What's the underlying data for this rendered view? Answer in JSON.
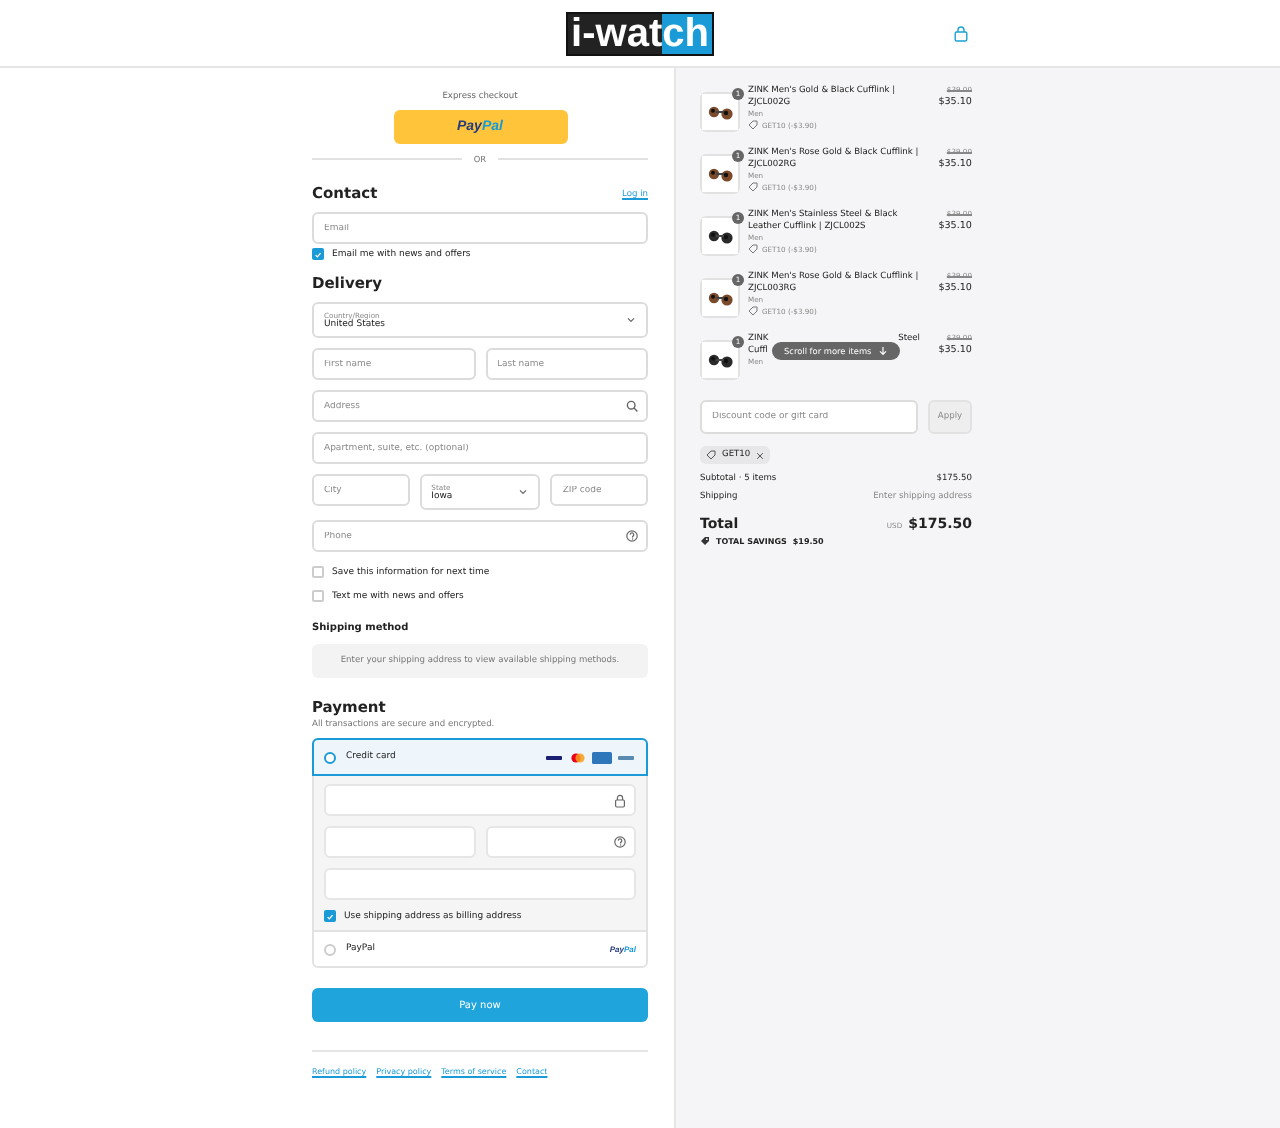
{
  "header": {
    "logo_parts": [
      {
        "text": "i-wat",
        "kind": "dark"
      },
      {
        "text": "ch",
        "kind": "blue"
      }
    ]
  },
  "express": {
    "label": "Express checkout",
    "paypal_parts": [
      {
        "text": "Pay",
        "kind": "dark"
      },
      {
        "text": "Pal",
        "kind": "light"
      }
    ],
    "divider": "OR"
  },
  "contact": {
    "heading": "Contact",
    "login_link": "Log in",
    "email_placeholder": "Email",
    "news_checkbox": {
      "label": "Email me with news and offers",
      "checked": true
    }
  },
  "delivery": {
    "heading": "Delivery",
    "rows": [
      [
        {
          "kind": "select",
          "label": "Country/Region",
          "value": "United States"
        }
      ],
      [
        {
          "kind": "input",
          "placeholder": "First name"
        },
        {
          "kind": "input",
          "placeholder": "Last name"
        }
      ],
      [
        {
          "kind": "address",
          "placeholder": "Address"
        }
      ],
      [
        {
          "kind": "input",
          "placeholder": "Apartment, suite, etc. (optional)"
        }
      ],
      [
        {
          "kind": "input",
          "placeholder": "City"
        },
        {
          "kind": "select",
          "label": "State",
          "value": "Iowa"
        },
        {
          "kind": "input",
          "placeholder": "ZIP code"
        }
      ],
      [
        {
          "kind": "phone",
          "placeholder": "Phone"
        }
      ]
    ],
    "checkboxes": [
      {
        "label": "Save this information for next time",
        "checked": false
      },
      {
        "label": "Text me with news and offers",
        "checked": false
      }
    ]
  },
  "shipping_method": {
    "heading": "Shipping method",
    "message": "Enter your shipping address to view available shipping methods."
  },
  "payment": {
    "heading": "Payment",
    "note": "All transactions are secure and encrypted.",
    "methods": [
      {
        "kind": "card",
        "label": "Credit card",
        "selected": true
      },
      {
        "kind": "paypal",
        "label": "PayPal",
        "selected": false,
        "logo_parts": [
          {
            "text": "Pay",
            "kind": "dark"
          },
          {
            "text": "Pal",
            "kind": "light"
          }
        ]
      }
    ],
    "card_fields": [
      [
        {
          "kind": "secure"
        }
      ],
      [
        {
          "kind": "plain"
        },
        {
          "kind": "help"
        }
      ],
      [
        {
          "kind": "plain"
        }
      ]
    ],
    "billing_checkbox": {
      "label": "Use shipping address as billing address",
      "checked": true
    }
  },
  "pay_button": "Pay now",
  "footer_links": [
    "Refund policy",
    "Privacy policy",
    "Terms of service",
    "Contact"
  ],
  "order": {
    "items": [
      {
        "quantity": "1",
        "title": "ZINK Men's Gold & Black Cufflink | ZJCL002G",
        "variant": "Men",
        "discount": "GET10 (-$3.90)",
        "old_price": "$39.00",
        "price": "$35.10"
      },
      {
        "quantity": "1",
        "title": "ZINK Men's Rose Gold & Black Cufflink | ZJCL002RG",
        "variant": "Men",
        "discount": "GET10 (-$3.90)",
        "old_price": "$39.00",
        "price": "$35.10"
      },
      {
        "quantity": "1",
        "title": "ZINK Men's Stainless Steel & Black Leather Cufflink | ZJCL002S",
        "variant": "Men",
        "discount": "GET10 (-$3.90)",
        "old_price": "$39.00",
        "price": "$35.10"
      },
      {
        "quantity": "1",
        "title": "ZINK Men's Rose Gold & Black Cufflink | ZJCL003RG",
        "variant": "Men",
        "discount": "GET10 (-$3.90)",
        "old_price": "$39.00",
        "price": "$35.10"
      },
      {
        "quantity": "1",
        "title_fragments": [
          "ZINK",
          "Steel",
          "Cuffl"
        ],
        "variant": "Men",
        "old_price": "$39.00",
        "price": "$35.10"
      }
    ],
    "scroll_hint": "Scroll for more items",
    "discount": {
      "placeholder": "Discount code or gift card",
      "button": "Apply",
      "code": "GET10"
    },
    "subtotal": {
      "label": "Subtotal · 5 items",
      "value": "$175.50"
    },
    "shipping": {
      "label": "Shipping",
      "value": "Enter shipping address"
    },
    "total": {
      "label": "Total",
      "currency": "USD",
      "value": "$175.50"
    },
    "savings": {
      "label": "TOTAL SAVINGS",
      "value": "$19.50"
    }
  }
}
